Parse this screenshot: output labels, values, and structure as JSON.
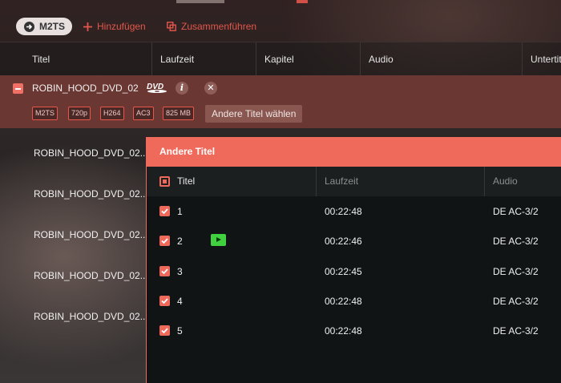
{
  "toolbar": {
    "format_label": "M2TS",
    "add_label": "Hinzufügen",
    "merge_label": "Zusammenführen"
  },
  "columns": [
    "Titel",
    "Laufzeit",
    "Kapitel",
    "Audio",
    "Untertitel"
  ],
  "disc": {
    "title": "ROBIN_HOOD_DVD_02",
    "tags": [
      "M2TS",
      "720p",
      "H264",
      "AC3",
      "825 MB"
    ],
    "other_titles_button": "Andere Titel wählen"
  },
  "list_items": [
    "ROBIN_HOOD_DVD_02..",
    "ROBIN_HOOD_DVD_02..",
    "ROBIN_HOOD_DVD_02..",
    "ROBIN_HOOD_DVD_02..",
    "ROBIN_HOOD_DVD_02.."
  ],
  "popup": {
    "title": "Andere Titel",
    "columns": [
      "Titel",
      "Laufzeit",
      "Audio"
    ],
    "rows": [
      {
        "num": "1",
        "duration": "00:22:48",
        "audio": "DE  AC-3/2"
      },
      {
        "num": "2",
        "duration": "00:22:46",
        "audio": "DE  AC-3/2"
      },
      {
        "num": "3",
        "duration": "00:22:45",
        "audio": "DE  AC-3/2"
      },
      {
        "num": "4",
        "duration": "00:22:48",
        "audio": "DE  AC-3/2"
      },
      {
        "num": "5",
        "duration": "00:22:48",
        "audio": "DE  AC-3/2"
      }
    ]
  },
  "colors": {
    "accent": "#f06a5c",
    "play": "#40d040",
    "selected_row": "#6b3733"
  }
}
